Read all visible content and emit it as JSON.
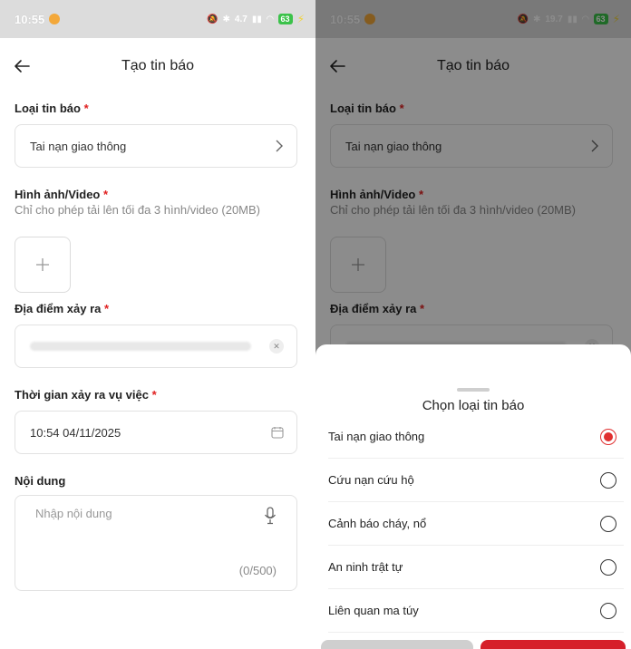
{
  "status": {
    "time": "10:55",
    "battery": "63",
    "net_left": "4.7",
    "net_right": "19.7",
    "net_unit": "KB/s"
  },
  "appbar": {
    "title": "Tạo tin báo"
  },
  "form": {
    "type_label": "Loại tin báo",
    "type_value": "Tai nạn giao thông",
    "media_label": "Hình ảnh/Video",
    "media_hint": "Chỉ cho phép tải lên tối đa 3 hình/video (20MB)",
    "location_label": "Địa điểm xảy ra",
    "time_label": "Thời gian xảy ra vụ việc",
    "time_value": "10:54 04/11/2025",
    "content_label": "Nội dung",
    "content_placeholder": "Nhập nội dung",
    "content_counter": "(0/500)",
    "required_mark": "*"
  },
  "sheet": {
    "title": "Chọn loại tin báo",
    "options": [
      {
        "label": "Tai nạn giao thông",
        "selected": true
      },
      {
        "label": "Cứu nạn cứu hộ",
        "selected": false
      },
      {
        "label": "Cảnh báo cháy, nổ",
        "selected": false
      },
      {
        "label": "An ninh trật tự",
        "selected": false
      },
      {
        "label": "Liên quan ma túy",
        "selected": false
      }
    ]
  },
  "colors": {
    "accent": "#e03030",
    "required": "#e02020",
    "confirm_button": "#d61f2a",
    "cancel_button": "#cfcfcf"
  },
  "icons": [
    "back-arrow-icon",
    "chevron-right-icon",
    "plus-icon",
    "clear-icon",
    "calendar-icon",
    "microphone-icon",
    "radio-icon"
  ]
}
